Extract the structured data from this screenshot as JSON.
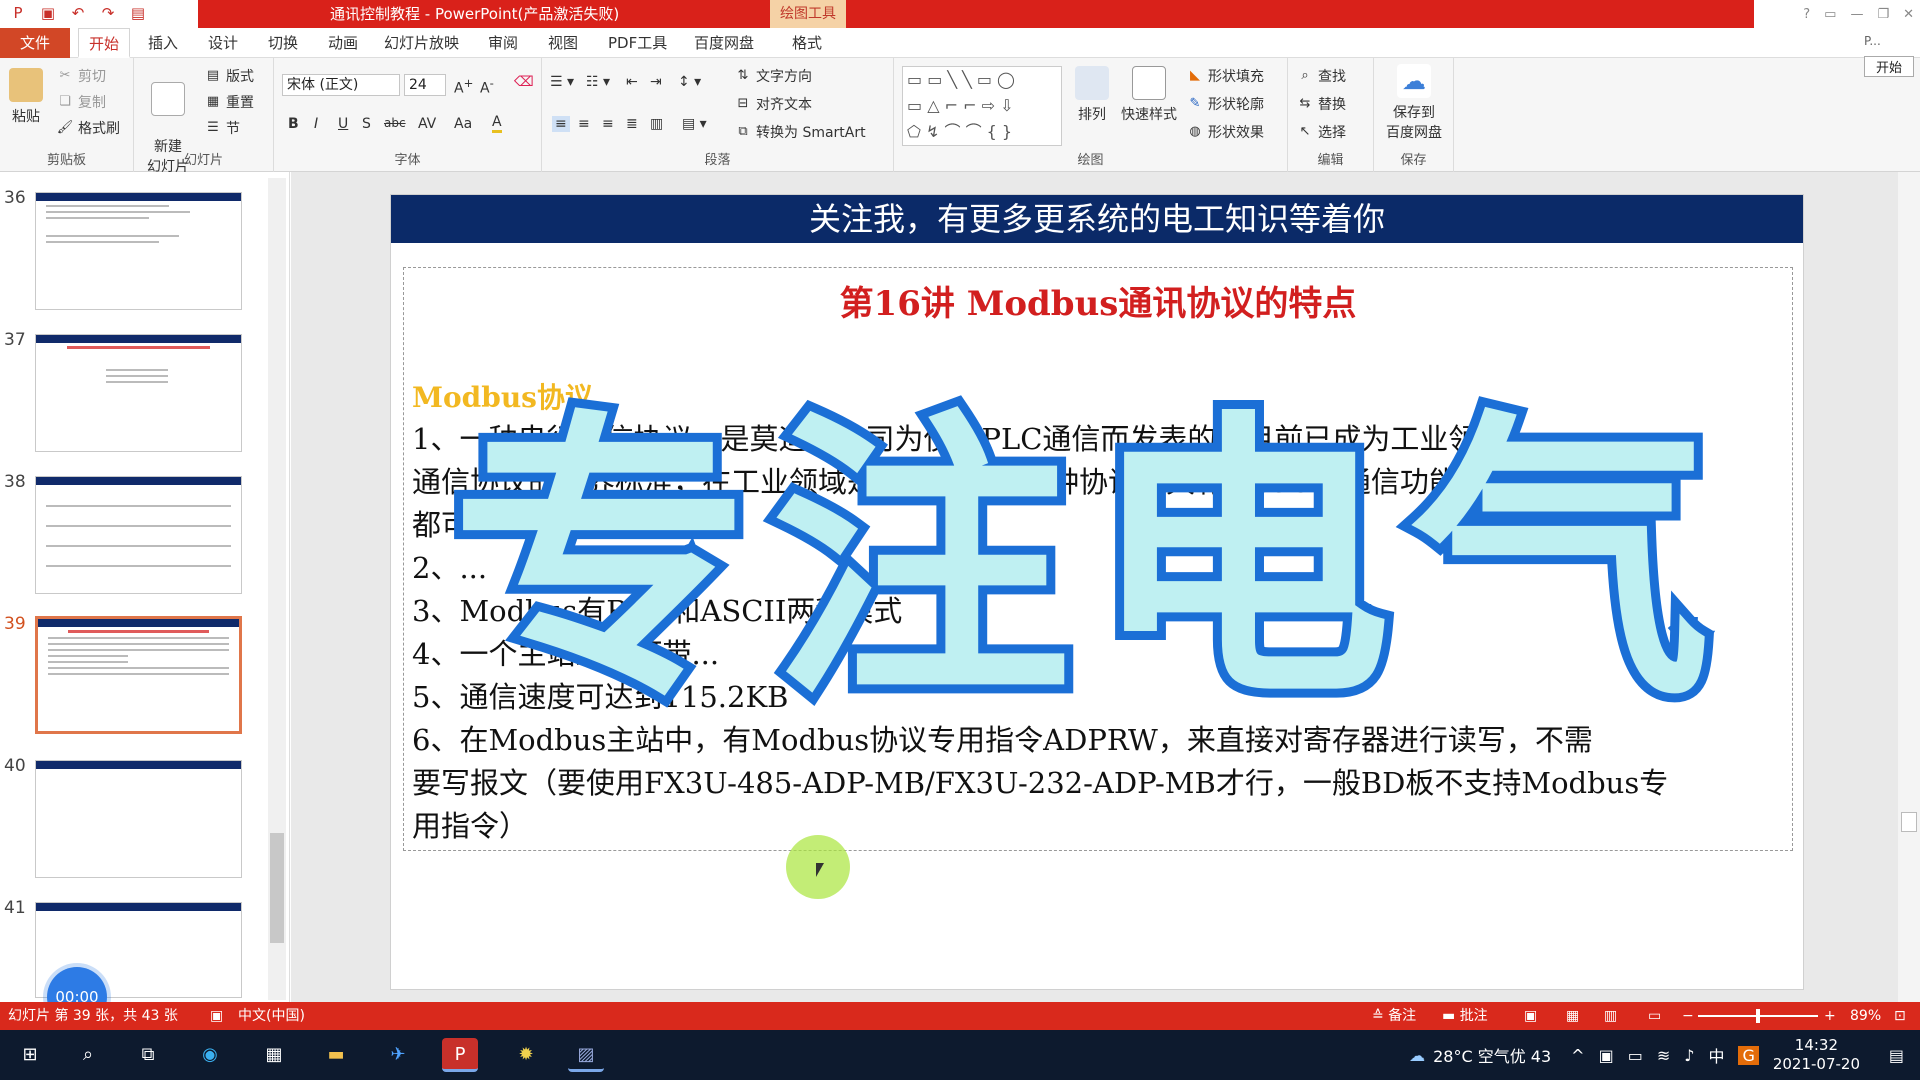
{
  "titlebar": {
    "title": "通讯控制教程 - PowerPoint(产品激活失败)",
    "context_tab": "绘图工具"
  },
  "tabs": [
    "文件",
    "开始",
    "插入",
    "设计",
    "切换",
    "动画",
    "幻灯片放映",
    "审阅",
    "视图",
    "PDF工具",
    "百度网盘",
    "格式"
  ],
  "ribbon": {
    "clipboard": {
      "paste": "粘贴",
      "cut": "剪切",
      "copy": "复制",
      "format_painter": "格式刷",
      "label": "剪贴板"
    },
    "slides": {
      "new_slide": "新建\n幻灯片",
      "layout": "版式",
      "reset": "重置",
      "section": "节",
      "label": "幻灯片"
    },
    "font": {
      "name": "宋体 (正文)",
      "size": "24",
      "label": "字体"
    },
    "paragraph": {
      "text_direction": "文字方向",
      "align_text": "对齐文本",
      "smartart": "转换为 SmartArt",
      "label": "段落"
    },
    "drawing": {
      "arrange": "排列",
      "quick_styles": "快速样式",
      "shape_fill": "形状填充",
      "shape_outline": "形状轮廓",
      "shape_effects": "形状效果",
      "label": "绘图"
    },
    "editing": {
      "find": "查找",
      "replace": "替换",
      "select": "选择",
      "label": "编辑"
    },
    "save": {
      "save_baidu": "保存到\n百度网盘",
      "label": "保存"
    },
    "right_panel": {
      "p": "P...",
      "start": "开始"
    }
  },
  "thumbnails": [
    {
      "num": "36",
      "selected": false
    },
    {
      "num": "37",
      "selected": false
    },
    {
      "num": "38",
      "selected": false
    },
    {
      "num": "39",
      "selected": true
    },
    {
      "num": "40",
      "selected": false
    },
    {
      "num": "41",
      "selected": false
    }
  ],
  "slide": {
    "header": "关注我，有更多更系统的电工知识等着你",
    "title": "第16讲  Modbus通讯协议的特点",
    "subtitle": "Modbus协议",
    "lines": [
      "1、一种串行通信协议，是莫迪康公司为使用PLC通信而发表的，目前已成为工业领域",
      "通信协议的业界标准，在工业领域是比较通用的一种协议，具有Modbus通信功能的设备",
      "都可以做Modbus",
      "2、...",
      "3、Modbus有RTU和ASCII两种模式",
      "4、一个主站最多可带...",
      "5、通信速度可达到115.2KB",
      "6、在Modbus主站中，有Modbus协议专用指令ADPRW，来直接对寄存器进行读写，不需",
      "要写报文（要使用FX3U-485-ADP-MB/FX3U-232-ADP-MB才行，一般BD板不支持Modbus专",
      "用指令）"
    ],
    "watermark": "专注电气"
  },
  "timer": "00:00",
  "statusbar": {
    "slide_info": "幻灯片 第 39 张，共 43 张",
    "language": "中文(中国)",
    "notes": "备注",
    "comments": "批注",
    "zoom": "89%"
  },
  "taskbar": {
    "weather": "28°C 空气优 43",
    "ime": "中",
    "time": "14:32",
    "date": "2021-07-20"
  },
  "colors": {
    "accent": "#d9211a",
    "header_navy": "#0b2a68",
    "title_red": "#d21f1f",
    "subtitle_yellow": "#f2b821",
    "watermark_fill": "#bff0f2",
    "watermark_stroke": "#1b6fd6"
  }
}
